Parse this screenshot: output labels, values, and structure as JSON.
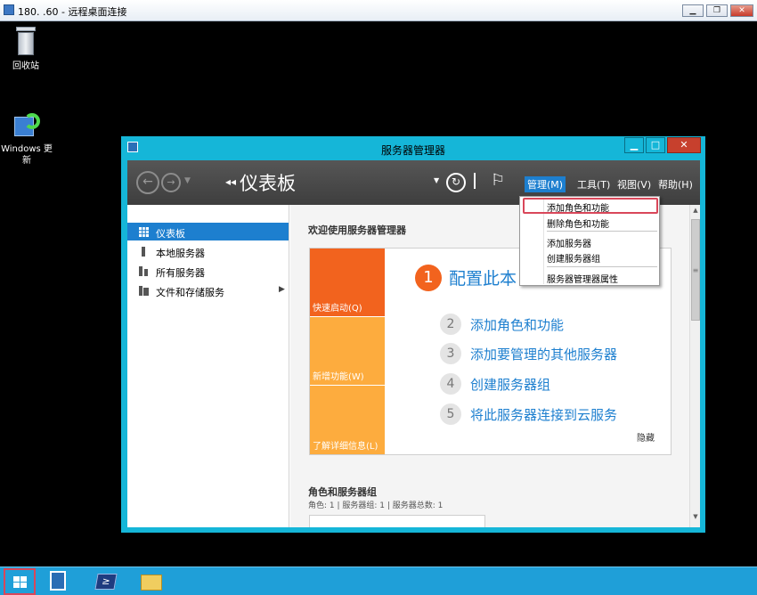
{
  "rdp": {
    "title": "180.      .60 - 远程桌面连接",
    "minimize_label": "▁",
    "restore_label": "❐",
    "close_label": "✕"
  },
  "desktop": {
    "recycle_bin_label": "回收站",
    "windows_update_label": "Windows 更新"
  },
  "window": {
    "title": "服务器管理器",
    "minimize_label": "▁",
    "maximize_label": "□",
    "close_label": "✕"
  },
  "toolbar": {
    "back_glyph": "←",
    "forward_glyph": "→",
    "dropdown_glyph": "▼",
    "breadcrumb_arrows": "◂◂",
    "breadcrumb_title": "仪表板",
    "caret_glyph": "▼",
    "refresh_glyph": "↻",
    "flag_glyph": "⚐",
    "menus": [
      "管理(M)",
      "工具(T)",
      "视图(V)",
      "帮助(H)"
    ]
  },
  "dropdown": {
    "items": [
      "添加角色和功能",
      "删除角色和功能",
      "添加服务器",
      "创建服务器组",
      "服务器管理器属性"
    ]
  },
  "leftnav": {
    "items": [
      "仪表板",
      "本地服务器",
      "所有服务器",
      "文件和存储服务"
    ],
    "expand_glyph": "▶"
  },
  "main": {
    "welcome": "欢迎使用服务器管理器",
    "tiles": [
      "快速启动(Q)",
      "新增功能(W)",
      "了解详细信息(L)"
    ],
    "step1": {
      "num": "1",
      "text": "配置此本"
    },
    "steps": [
      {
        "num": "2",
        "text": "添加角色和功能"
      },
      {
        "num": "3",
        "text": "添加要管理的其他服务器"
      },
      {
        "num": "4",
        "text": "创建服务器组"
      },
      {
        "num": "5",
        "text": "将此服务器连接到云服务"
      }
    ],
    "hide_label": "隐藏",
    "roles_heading": "角色和服务器组",
    "roles_summary": "角色: 1 | 服务器组: 1 | 服务器总数: 1"
  },
  "scrollbar": {
    "up_glyph": "▲",
    "grip_glyph": "≡",
    "down_glyph": "▼"
  },
  "taskbar": {
    "powershell_glyph": "≥"
  },
  "colors": {
    "accent": "#1d7fcf",
    "window_frame": "#15b6d8",
    "tile_orange": "#f2631e",
    "tile_amber": "#fdac3e",
    "taskbar": "#1f9fd8",
    "highlight_border": "#d9475a"
  }
}
